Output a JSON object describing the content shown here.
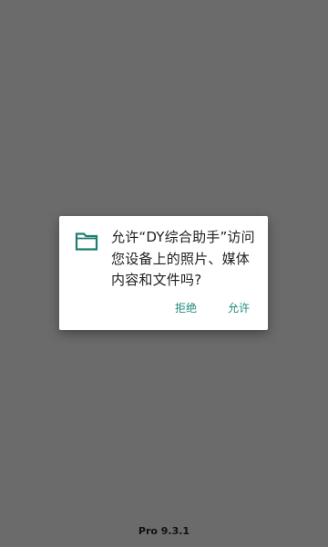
{
  "dialog": {
    "icon": "folder-icon",
    "message": "允许“DY综合助手”访问您设备上的照片、媒体内容和文件吗?",
    "deny_label": "拒绝",
    "allow_label": "允许"
  },
  "footer": {
    "version": "Pro 9.3.1"
  },
  "colors": {
    "scrim": "#6b6b6b",
    "accent": "#1e8a7a",
    "dialog_bg": "#ffffff"
  }
}
